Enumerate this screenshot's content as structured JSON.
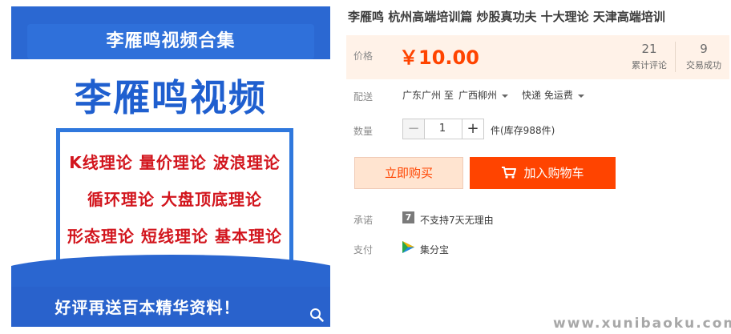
{
  "product_image": {
    "banner_title": "李雁鸣视频合集",
    "headline": "李雁鸣视频",
    "theory_lines": [
      "K线理论 量价理论 波浪理论",
      "循环理论 大盘顶底理论",
      "形态理论 短线理论 基本理论"
    ],
    "bottom_text": "好评再送百本精华资料！",
    "zoom_icon": "search-icon"
  },
  "title": "李雁鸣 杭州高端培训篇 炒股真功夫 十大理论 天津高端培训",
  "price": {
    "label": "价格",
    "value": "￥10.00",
    "reviews_count": "21",
    "reviews_label": "累计评论",
    "sales_count": "9",
    "sales_label": "交易成功"
  },
  "shipping": {
    "label": "配送",
    "origin": "广东广州 至",
    "destination": "广西柳州",
    "method": "快递 免运费"
  },
  "quantity": {
    "label": "数量",
    "minus": "−",
    "value": "1",
    "plus": "+",
    "stock": "件(库存988件)"
  },
  "buttons": {
    "buy_now": "立即购买",
    "add_to_cart": "加入购物车"
  },
  "promise": {
    "label": "承诺",
    "icon_text": "7",
    "text": "不支持7天无理由"
  },
  "payment": {
    "label": "支付",
    "text": "集分宝"
  },
  "watermark": "www.xunibaoku.com",
  "colors": {
    "accent": "#ff4400",
    "price_bg": "#fff2e8",
    "image_blue": "#2f6fd6",
    "theory_red": "#d2151d"
  }
}
